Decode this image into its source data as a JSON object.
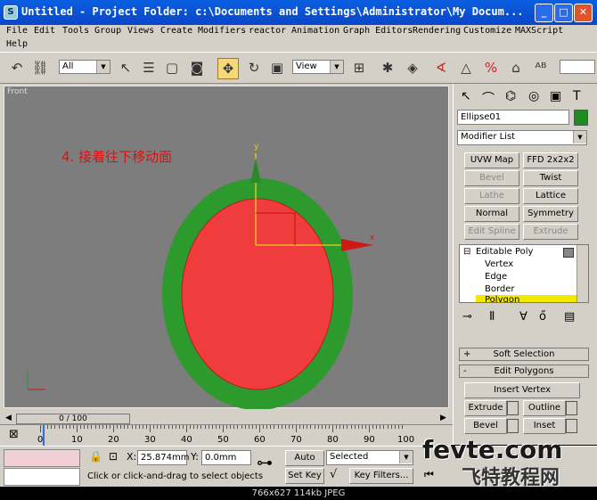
{
  "window": {
    "title": "Untitled    - Project Folder: c:\\Documents and Settings\\Administrator\\My Docum...",
    "minimize": "_",
    "maximize": "□",
    "close": "✕"
  },
  "menu": {
    "row1": [
      "File",
      "Edit",
      "Tools",
      "Group",
      "Views",
      "Create",
      "Modifiers",
      "reactor",
      "Animation",
      "Graph Editors",
      "Rendering",
      "Customize",
      "MAXScript"
    ],
    "row2": [
      "Help"
    ]
  },
  "toolbar": {
    "selection_filter": "All",
    "reference_coord": "View"
  },
  "viewport": {
    "label": "Front",
    "annotation": "4. 接着往下移动面",
    "gizmo_y": "y",
    "gizmo_x": "x"
  },
  "command_panel": {
    "object_name": "Ellipse01",
    "object_color": "#1e8c1e",
    "modifier_list": "Modifier List",
    "buttons": [
      {
        "label": "UVW Map",
        "enabled": true
      },
      {
        "label": "FFD 2x2x2",
        "enabled": true
      },
      {
        "label": "Bevel",
        "enabled": false
      },
      {
        "label": "Twist",
        "enabled": true
      },
      {
        "label": "Lathe",
        "enabled": false
      },
      {
        "label": "Lattice",
        "enabled": true
      },
      {
        "label": "Normal",
        "enabled": true
      },
      {
        "label": "Symmetry",
        "enabled": true
      },
      {
        "label": "Edit Spline",
        "enabled": false
      },
      {
        "label": "Extrude",
        "enabled": false
      }
    ],
    "stack": [
      "Editable Poly",
      "Vertex",
      "Edge",
      "Border",
      "Polygon"
    ],
    "rollouts": {
      "soft_selection": "Soft Selection",
      "edit_polygons": "Edit Polygons",
      "plus": "+",
      "minus": "-"
    },
    "edit_buttons": {
      "insert_vertex": "Insert Vertex",
      "extrude": "Extrude",
      "outline": "Outline",
      "bevel": "Bevel",
      "inset": "Inset"
    }
  },
  "timeline": {
    "slider_label": "0 / 100",
    "ticks": [
      "0",
      "10",
      "20",
      "30",
      "40",
      "50",
      "60",
      "70",
      "80",
      "90",
      "100"
    ]
  },
  "status": {
    "x_label": "X:",
    "x_value": "25.874mm",
    "y_label": "Y:",
    "y_value": "0.0mm",
    "auto_key": "Auto Key",
    "set_key": "Set Key",
    "key_mode": "Selected",
    "key_filters": "Key Filters...",
    "prompt": "Click or click-and-drag to select objects"
  },
  "image_caption": "766x627  114kb  JPEG",
  "watermark": {
    "line1": "fevte.com",
    "line2": "飞特教程网"
  },
  "colors": {
    "outer_ellipse": "#2c9a2c",
    "inner_ellipse": "#f03c3c",
    "annotation": "#e01010"
  }
}
